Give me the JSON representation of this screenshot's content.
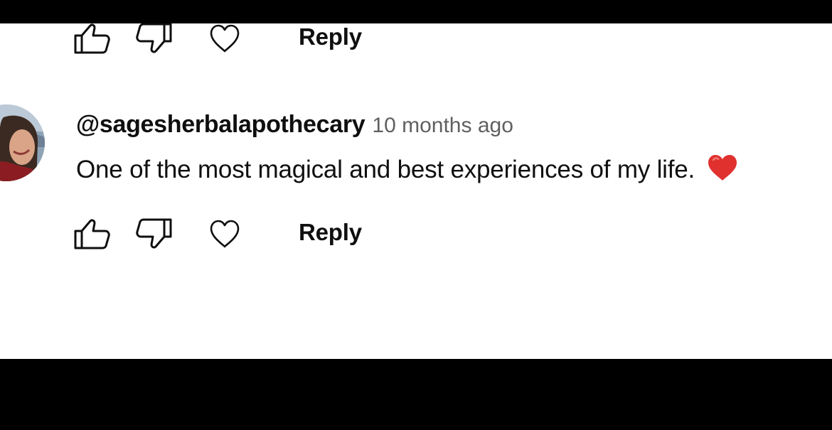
{
  "previous_comment": {
    "reply_label": "Reply"
  },
  "comment": {
    "author": "@sagesherbalapothecary",
    "time": "10 months ago",
    "text": "One of the most magical and best experiences of my life.",
    "emoji": "red-heart-emoji",
    "reply_label": "Reply"
  },
  "icons": {
    "like": "thumbs-up-icon",
    "dislike": "thumbs-down-icon",
    "love": "heart-outline-icon"
  },
  "colors": {
    "background": "#ffffff",
    "letterbox": "#000000",
    "text": "#0f0f0f",
    "secondary_text": "#606060",
    "emoji_red": "#e0312f"
  }
}
